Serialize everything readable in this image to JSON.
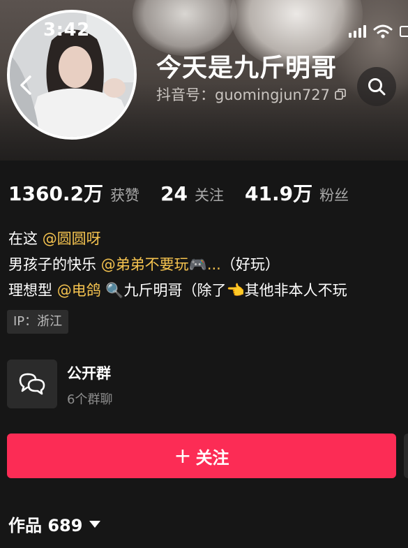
{
  "status_bar": {
    "time": "3:42"
  },
  "profile": {
    "name": "今天是九斤明哥",
    "douyin_id": "抖音号：guomingjun727"
  },
  "stats": [
    {
      "value": "1360.2万",
      "label": "获赞"
    },
    {
      "value": "24",
      "label": "关注"
    },
    {
      "value": "41.9万",
      "label": "粉丝"
    }
  ],
  "bio": {
    "line1_prefix": "在这 ",
    "line1_mention": "@圆圆呀",
    "line2_prefix": "男孩子的快乐 ",
    "line2_mention": "@弟弟不要玩🎮...",
    "line2_suffix": "（好玩）",
    "line3_prefix": "理想型 ",
    "line3_mention": "@电鸽",
    "line3_suffix": " 🔍九斤明哥（除了👈其他非本人不玩"
  },
  "ip_tag": "IP：浙江",
  "group": {
    "title": "公开群",
    "subtitle": "6个群聊"
  },
  "follow_button": {
    "plus": "+",
    "label": "关注"
  },
  "works": {
    "label": "作品 689"
  },
  "colors": {
    "accent": "#fc2c55",
    "mention": "#f5c34f",
    "background": "#161616"
  },
  "icons": [
    "back-icon",
    "search-icon",
    "copy-icon",
    "group-chat-icon",
    "signal-icon",
    "wifi-icon",
    "battery-icon",
    "caret-down-icon"
  ]
}
